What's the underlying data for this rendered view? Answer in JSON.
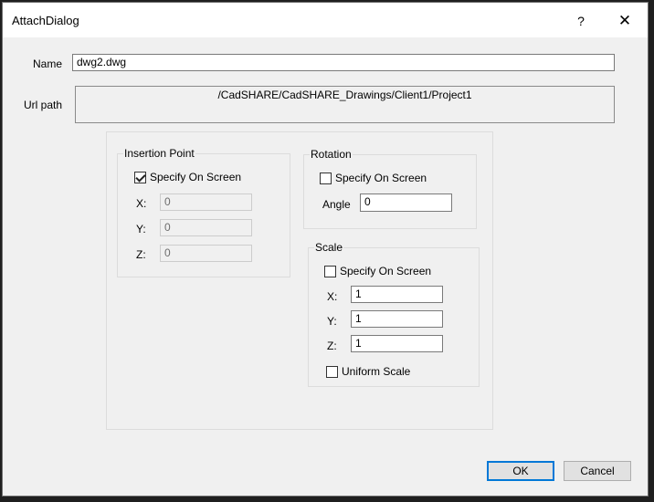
{
  "window": {
    "title": "AttachDialog",
    "help": "?",
    "close": "✕"
  },
  "name": {
    "label": "Name",
    "value": "dwg2.dwg"
  },
  "url": {
    "label": "Url path",
    "value": "/CadSHARE/CadSHARE_Drawings/Client1/Project1"
  },
  "insertion": {
    "title": "Insertion Point",
    "specify_label": "Specify On Screen",
    "specify_checked": true,
    "x_label": "X:",
    "x_value": "0",
    "y_label": "Y:",
    "y_value": "0",
    "z_label": "Z:",
    "z_value": "0"
  },
  "rotation": {
    "title": "Rotation",
    "specify_label": "Specify On Screen",
    "specify_checked": false,
    "angle_label": "Angle",
    "angle_value": "0"
  },
  "scale": {
    "title": "Scale",
    "specify_label": "Specify On Screen",
    "specify_checked": false,
    "x_label": "X:",
    "x_value": "1",
    "y_label": "Y:",
    "y_value": "1",
    "z_label": "Z:",
    "z_value": "1",
    "uniform_label": "Uniform Scale",
    "uniform_checked": false
  },
  "buttons": {
    "ok": "OK",
    "cancel": "Cancel"
  }
}
